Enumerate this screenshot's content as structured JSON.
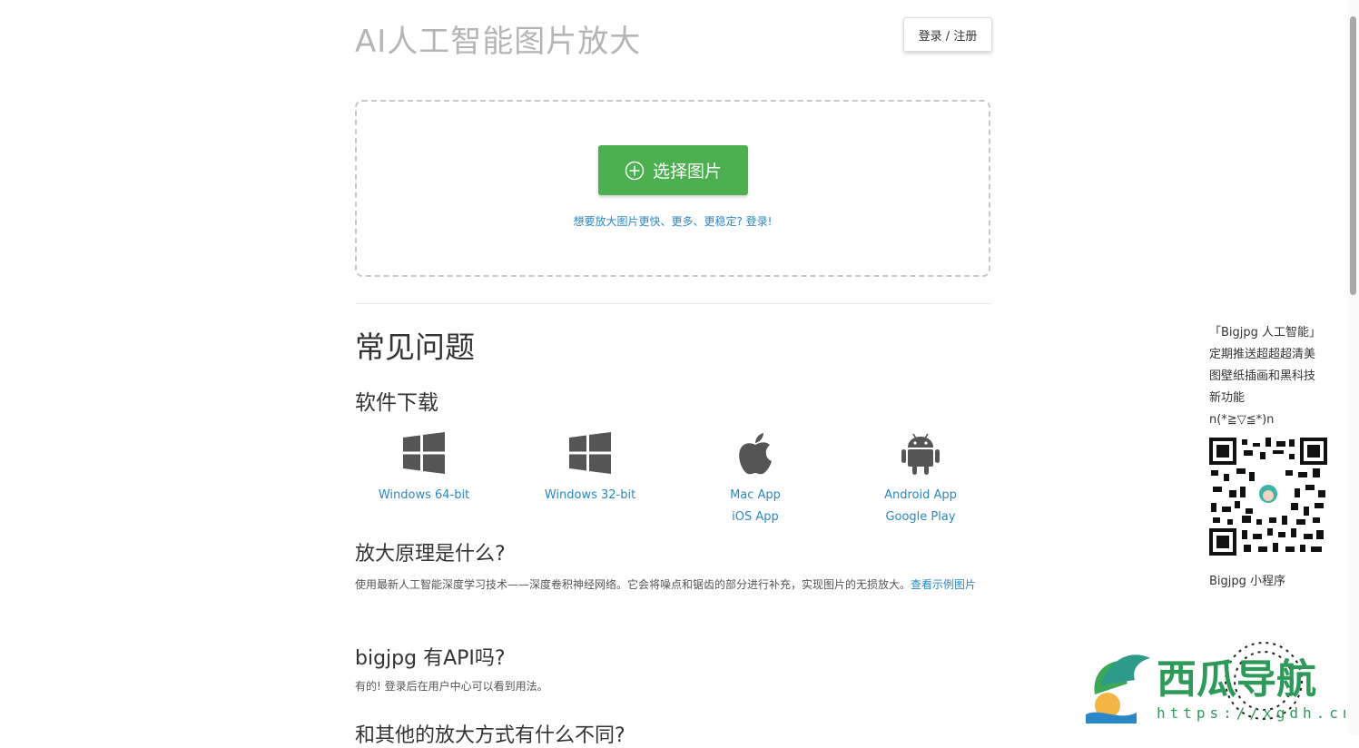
{
  "header": {
    "title": "AI人工智能图片放大",
    "login_label": "登录 / 注册"
  },
  "upload": {
    "choose_label": "选择图片",
    "hint": "想要放大图片更快、更多、更稳定? 登录!"
  },
  "faq": {
    "title": "常见问题",
    "download": {
      "heading": "软件下载",
      "items": [
        {
          "icon": "windows-icon",
          "links": [
            "Windows 64-bit"
          ]
        },
        {
          "icon": "windows-icon",
          "links": [
            "Windows 32-bit"
          ]
        },
        {
          "icon": "apple-icon",
          "links": [
            "Mac App",
            "iOS App"
          ]
        },
        {
          "icon": "android-icon",
          "links": [
            "Android App",
            "Google Play"
          ]
        }
      ]
    },
    "principle": {
      "heading": "放大原理是什么?",
      "text": "使用最新人工智能深度学习技术——深度卷积神经网络。它会将噪点和锯齿的部分进行补充，实现图片的无损放大。",
      "link": "查看示例图片"
    },
    "api": {
      "heading": "bigjpg 有API吗?",
      "text": "有的! 登录后在用户中心可以看到用法。"
    },
    "compare": {
      "heading": "和其他的放大方式有什么不同?"
    }
  },
  "sidebar": {
    "promo_lines": [
      "「Bigjpg 人工智能」",
      "定期推送超超超清美",
      "图壁纸插画和黑科技",
      "新功能",
      "n(*≧▽≦*)n"
    ],
    "qr_icon": "qr-code-icon",
    "miniprogram_label": "Bigjpg 小程序"
  },
  "watermark": {
    "title": "西瓜导航",
    "url": "https://xgdh.cn"
  },
  "colors": {
    "primary_green": "#4caf50",
    "link_blue": "#2a88c8",
    "title_gray": "#b5b5b5"
  }
}
